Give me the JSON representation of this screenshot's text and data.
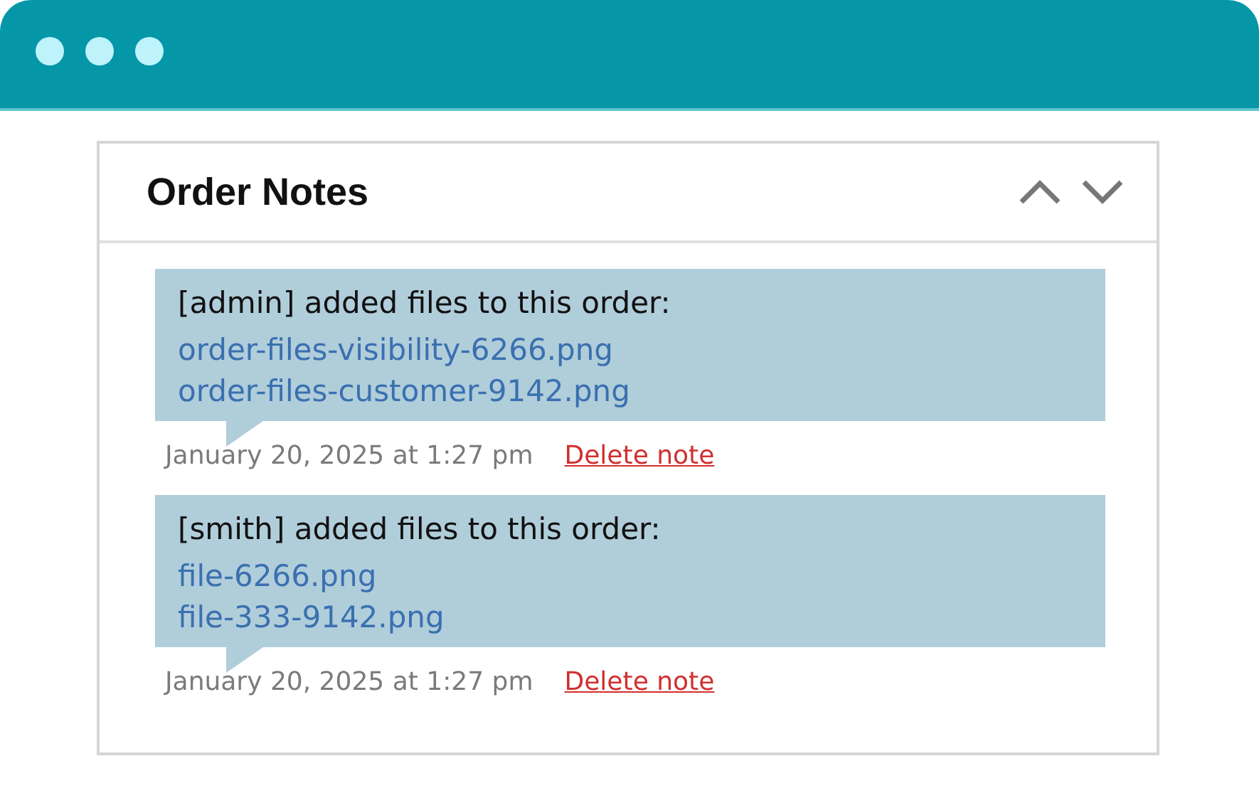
{
  "panel": {
    "title": "Order Notes"
  },
  "notes": [
    {
      "text": "[admin] added files to this order:",
      "files": [
        "order-files-visibility-6266.png",
        "order-files-customer-9142.png"
      ],
      "date": "January 20, 2025 at 1:27 pm",
      "action": "Delete note"
    },
    {
      "text": "[smith] added files to this order:",
      "files": [
        "file-6266.png",
        "file-333-9142.png"
      ],
      "date": "January 20, 2025 at 1:27 pm",
      "action": "Delete note"
    }
  ]
}
